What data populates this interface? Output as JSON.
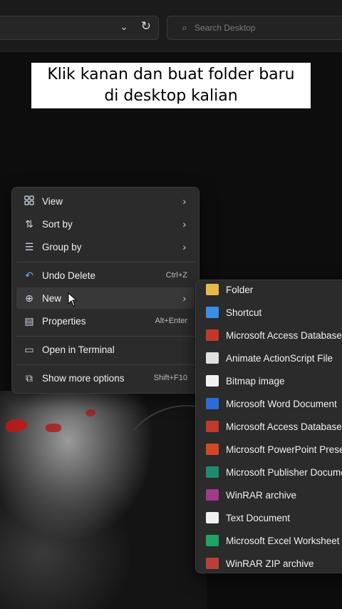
{
  "toolbar": {
    "search_placeholder": "Search Desktop"
  },
  "caption": {
    "line1": "Klik kanan dan buat folder baru",
    "line2": "di desktop kalian"
  },
  "context_menu": {
    "view": "View",
    "sort_by": "Sort by",
    "group_by": "Group by",
    "undo_delete": "Undo Delete",
    "undo_delete_shortcut": "Ctrl+Z",
    "new": "New",
    "properties": "Properties",
    "properties_shortcut": "Alt+Enter",
    "open_in_terminal": "Open in Terminal",
    "show_more_options": "Show more options",
    "show_more_options_shortcut": "Shift+F10"
  },
  "new_submenu": {
    "items": [
      {
        "label": "Folder",
        "color": "#e8b84a"
      },
      {
        "label": "Shortcut",
        "color": "#3a8ee6"
      },
      {
        "label": "Microsoft Access Database",
        "color": "#c0392b"
      },
      {
        "label": "Animate ActionScript File",
        "color": "#e0e0e0"
      },
      {
        "label": "Bitmap image",
        "color": "#f2f2f2"
      },
      {
        "label": "Microsoft Word Document",
        "color": "#2b6cd6"
      },
      {
        "label": "Microsoft Access Database",
        "color": "#c0392b"
      },
      {
        "label": "Microsoft PowerPoint Presentation",
        "color": "#d24726"
      },
      {
        "label": "Microsoft Publisher Document",
        "color": "#1f8a70"
      },
      {
        "label": "WinRAR archive",
        "color": "#a03a8c"
      },
      {
        "label": "Text Document",
        "color": "#f0f0f0"
      },
      {
        "label": "Microsoft Excel Worksheet",
        "color": "#21a366"
      },
      {
        "label": "WinRAR ZIP archive",
        "color": "#b8403c"
      }
    ]
  }
}
